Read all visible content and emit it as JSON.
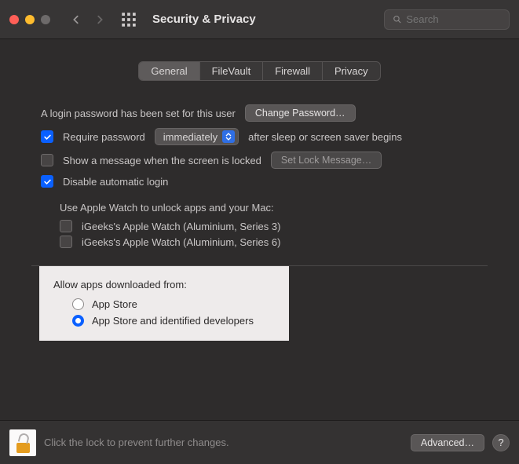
{
  "window": {
    "title": "Security & Privacy"
  },
  "search": {
    "placeholder": "Search"
  },
  "tabs": [
    {
      "label": "General",
      "active": true
    },
    {
      "label": "FileVault",
      "active": false
    },
    {
      "label": "Firewall",
      "active": false
    },
    {
      "label": "Privacy",
      "active": false
    }
  ],
  "general": {
    "login_password_text": "A login password has been set for this user",
    "change_password_label": "Change Password…",
    "require_password": {
      "checked": true,
      "prefix": "Require password",
      "select_value": "immediately",
      "suffix": "after sleep or screen saver begins"
    },
    "show_message": {
      "checked": false,
      "label": "Show a message when the screen is locked",
      "button_label": "Set Lock Message…"
    },
    "disable_auto_login": {
      "checked": true,
      "label": "Disable automatic login"
    },
    "apple_watch": {
      "heading": "Use Apple Watch to unlock apps and your Mac:",
      "devices": [
        {
          "checked": false,
          "label": "iGeeks's Apple Watch (Aluminium, Series 3)"
        },
        {
          "checked": false,
          "label": "iGeeks's Apple Watch (Aluminium, Series 6)"
        }
      ]
    },
    "allow_apps": {
      "heading": "Allow apps downloaded from:",
      "options": [
        {
          "label": "App Store",
          "selected": false
        },
        {
          "label": "App Store and identified developers",
          "selected": true
        }
      ]
    }
  },
  "footer": {
    "lock_hint": "Click the lock to prevent further changes.",
    "advanced_label": "Advanced…",
    "help_label": "?"
  }
}
